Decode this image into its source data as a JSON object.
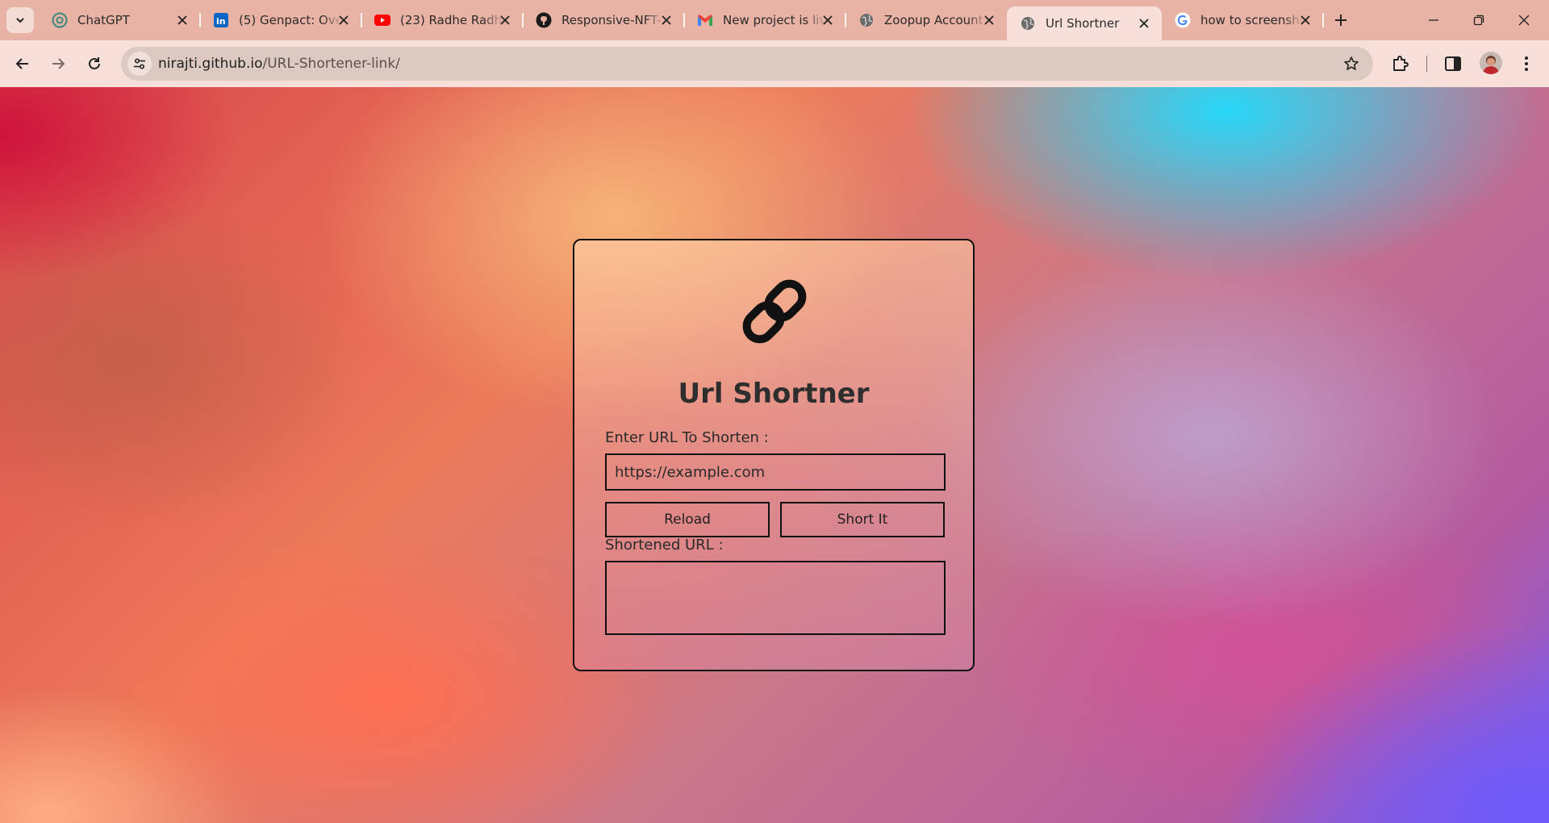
{
  "browser": {
    "tabs": [
      {
        "title": "ChatGPT",
        "icon": "chatgpt-icon"
      },
      {
        "title": "(5) Genpact: Overview",
        "icon": "linkedin-icon"
      },
      {
        "title": "(23) Radhe Radhe",
        "icon": "youtube-icon"
      },
      {
        "title": "Responsive-NFT-",
        "icon": "github-icon"
      },
      {
        "title": "New project is live",
        "icon": "gmail-icon"
      },
      {
        "title": "Zoopup Account",
        "icon": "globe-icon"
      },
      {
        "title": "Url Shortner",
        "icon": "globe-icon",
        "active": true
      },
      {
        "title": "how to screenshot",
        "icon": "google-icon"
      }
    ],
    "url_host": "nirajti.github.io",
    "url_path": "/URL-Shortener-link/"
  },
  "page": {
    "title": "Url Shortner",
    "input_label": "Enter URL To Shorten :",
    "input_placeholder": "https://example.com",
    "reload_label": "Reload",
    "short_label": "Short It",
    "output_label": "Shortened URL :",
    "output_value": ""
  }
}
